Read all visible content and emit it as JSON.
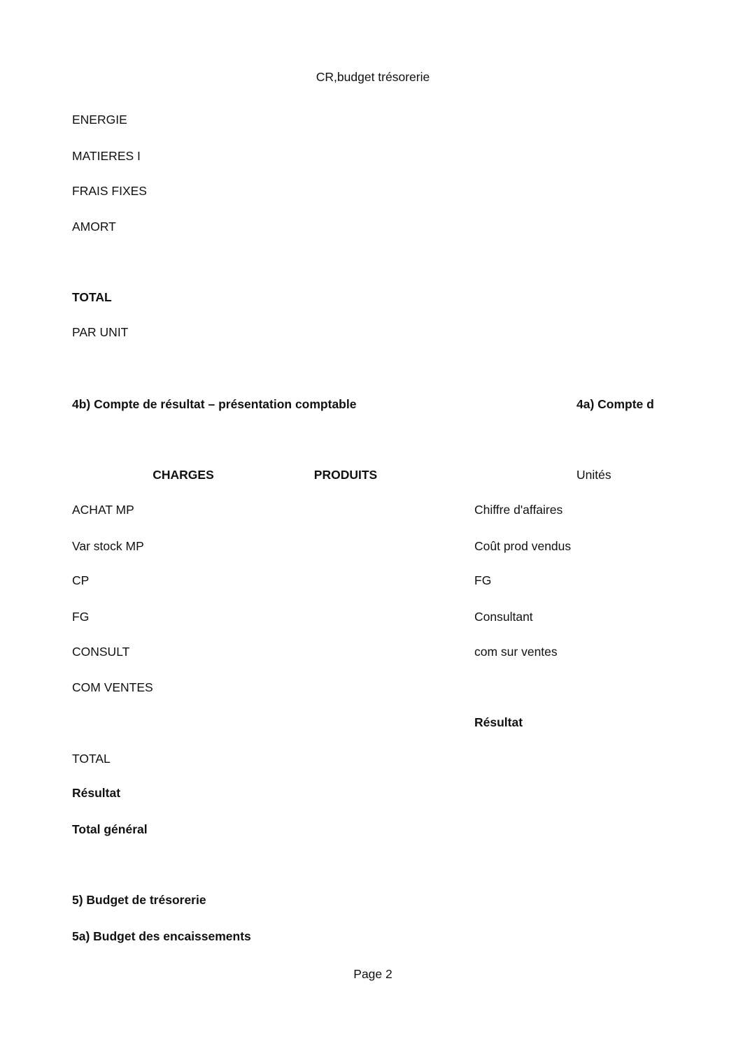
{
  "header": {
    "title": "CR,budget trésorerie"
  },
  "cost_items": [
    "ENERGIE",
    "MATIERES I",
    "FRAIS FIXES",
    "AMORT"
  ],
  "cost_total": "TOTAL",
  "cost_per_unit": "PAR UNIT",
  "section_4b": {
    "heading": "4b) Compte de résultat – présentation comptable",
    "charges_header": "CHARGES",
    "produits_header": "PRODUITS",
    "charges": [
      "ACHAT MP",
      "Var stock MP",
      "CP",
      "FG",
      "CONSULT",
      "COM VENTES"
    ],
    "total": "TOTAL",
    "resultat": "Résultat",
    "total_general": "Total général"
  },
  "section_4a": {
    "heading": "4a) Compte d",
    "units_header": "Unités",
    "rows": [
      "Chiffre d'affaires",
      "Coût prod vendus",
      "FG",
      "Consultant",
      "com sur ventes"
    ],
    "resultat": "Résultat"
  },
  "section_5": {
    "heading": "5) Budget de trésorerie",
    "sub_heading": "5a) Budget des encaissements"
  },
  "footer": {
    "page_label": "Page 2"
  }
}
